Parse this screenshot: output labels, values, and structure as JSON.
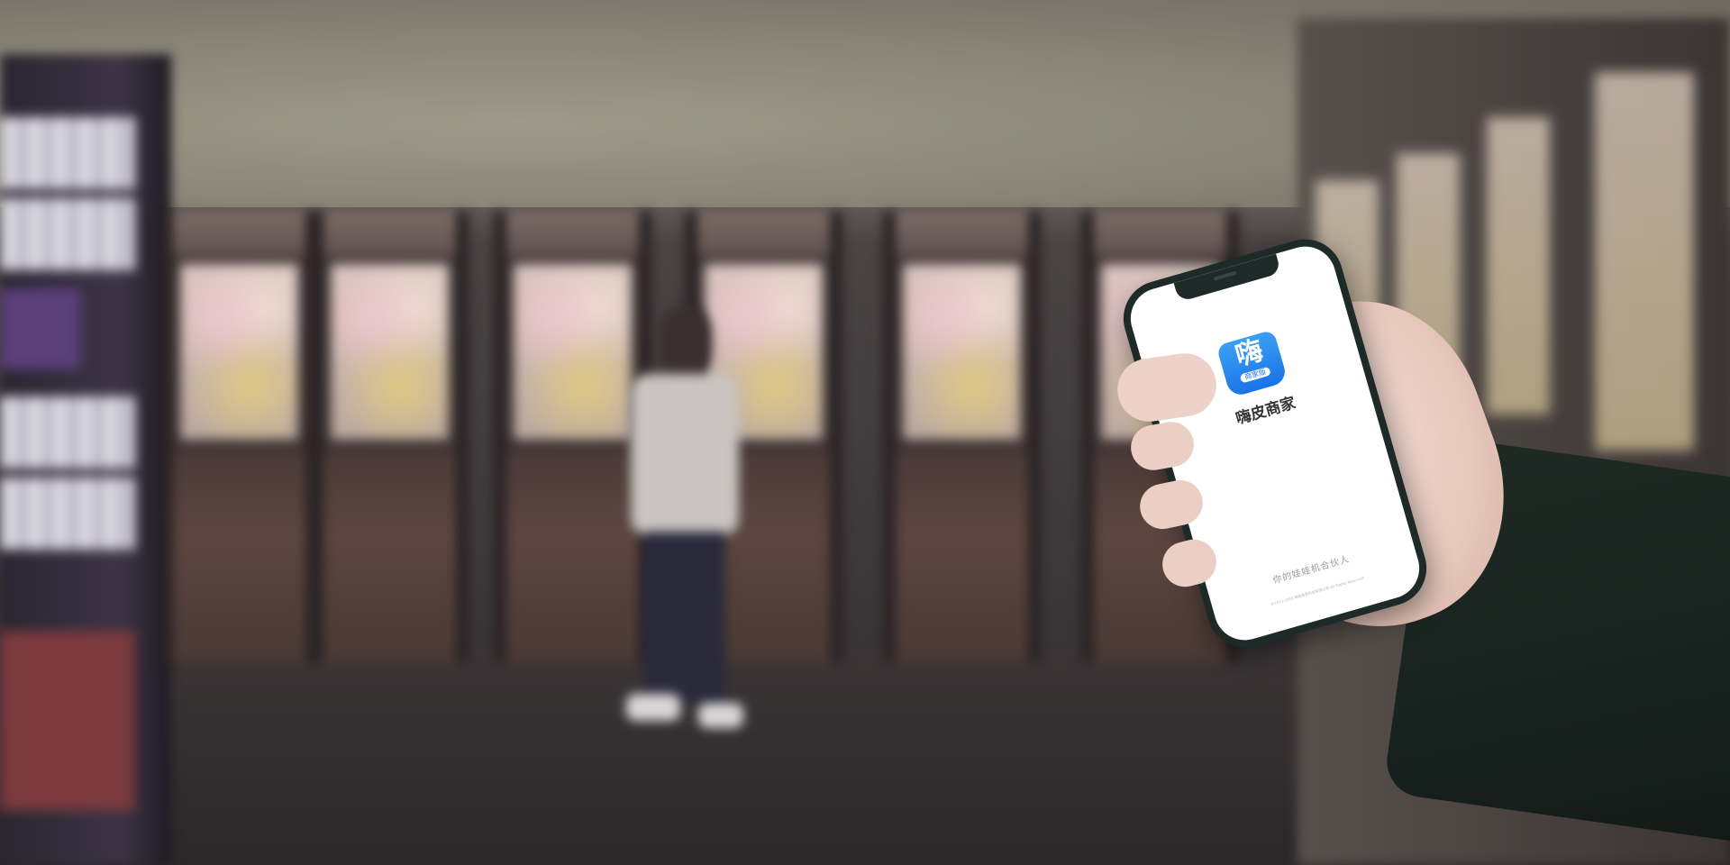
{
  "app": {
    "icon_glyph": "嗨",
    "icon_caption": "商家版",
    "name": "嗨皮商家",
    "slogan": "你的娃娃机合伙人",
    "copyright": "©2015-2019 嗨皮商家科技有限公司 All Rights Reserved"
  },
  "colors": {
    "icon_blue": "#1a73e8",
    "icon_light_blue": "#3aa0f5",
    "screen_bg": "#ffffff",
    "phone_frame": "#1d2a28",
    "sleeve": "#1f2a25"
  },
  "icons": {
    "app_icon": "hi-merchant-app-icon"
  }
}
